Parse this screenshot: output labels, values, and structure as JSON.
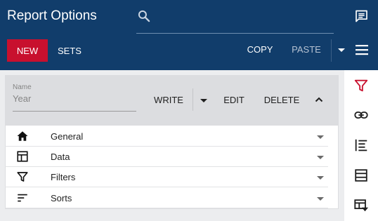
{
  "header": {
    "title": "Report Options",
    "search_icon": "search-icon",
    "chat_icon": "chat-icon"
  },
  "toolbar": {
    "new_label": "NEW",
    "sets_label": "SETS",
    "copy_label": "COPY",
    "paste_label": "PASTE",
    "menu_icon": "hamburger-menu-icon"
  },
  "panel": {
    "name_label": "Name",
    "name_value": "Year",
    "write_label": "WRITE",
    "edit_label": "EDIT",
    "delete_label": "DELETE"
  },
  "sections": [
    {
      "label": "General",
      "icon": "home-icon"
    },
    {
      "label": "Data",
      "icon": "table-layout-icon"
    },
    {
      "label": "Filters",
      "icon": "filter-icon"
    },
    {
      "label": "Sorts",
      "icon": "sort-icon"
    }
  ],
  "sidebar": {
    "icons": [
      "filter-icon",
      "link-icon",
      "indent-list-icon",
      "list-view-icon",
      "table-filter-icon"
    ]
  },
  "colors": {
    "header_bg": "#113d6b",
    "accent_red": "#c8102e",
    "panel_top_bg": "#dcdde0",
    "page_bg": "#ecedef"
  }
}
